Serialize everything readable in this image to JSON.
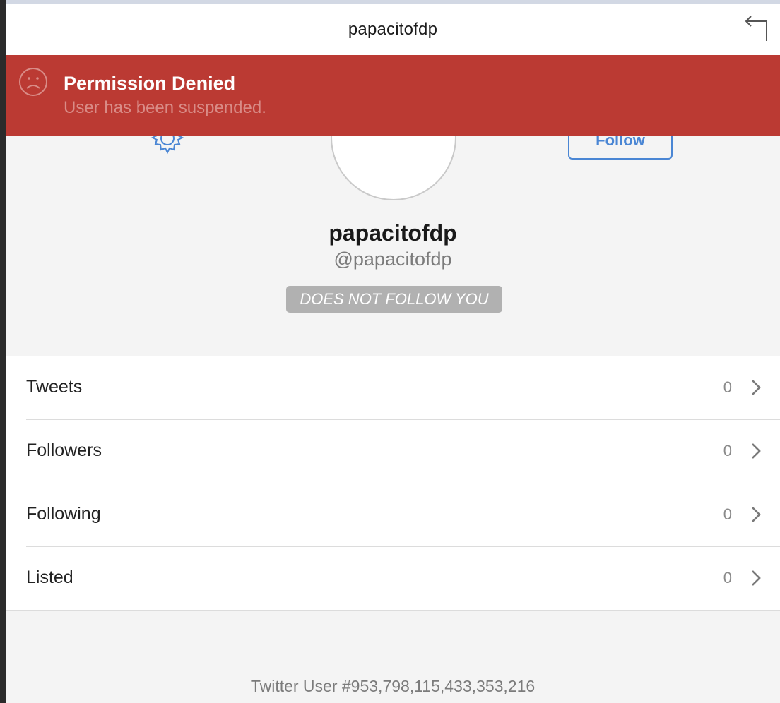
{
  "nav": {
    "title": "papacitofdp",
    "back_icon": "return-arrow-icon"
  },
  "banner": {
    "icon": "sad-face-icon",
    "title": "Permission Denied",
    "message": "User has been suspended.",
    "background_color": "#bb3a33"
  },
  "profile": {
    "settings_icon": "gear-icon",
    "follow_label": "Follow",
    "display_name": "papacitofdp",
    "handle": "@papacitofdp",
    "relationship_badge": "DOES NOT FOLLOW YOU",
    "accent_color": "#4a86d4"
  },
  "stats": [
    {
      "label": "Tweets",
      "value": "0"
    },
    {
      "label": "Followers",
      "value": "0"
    },
    {
      "label": "Following",
      "value": "0"
    },
    {
      "label": "Listed",
      "value": "0"
    }
  ],
  "footer": {
    "user_id_text": "Twitter User #953,798,115,433,353,216"
  }
}
